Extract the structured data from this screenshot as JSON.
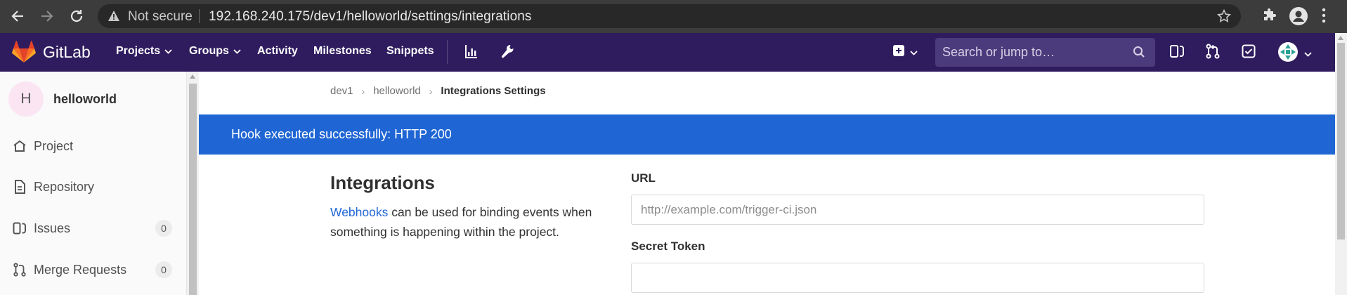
{
  "browser": {
    "security_label": "Not secure",
    "url": "192.168.240.175/dev1/helloworld/settings/integrations"
  },
  "topnav": {
    "brand": "GitLab",
    "items": [
      {
        "label": "Projects"
      },
      {
        "label": "Groups"
      },
      {
        "label": "Activity"
      },
      {
        "label": "Milestones"
      },
      {
        "label": "Snippets"
      }
    ],
    "search_placeholder": "Search or jump to…"
  },
  "sidebar": {
    "project_initial": "H",
    "project_name": "helloworld",
    "items": [
      {
        "label": "Project"
      },
      {
        "label": "Repository"
      },
      {
        "label": "Issues",
        "count": "0"
      },
      {
        "label": "Merge Requests",
        "count": "0"
      }
    ]
  },
  "breadcrumb": {
    "items": [
      "dev1",
      "helloworld"
    ],
    "current": "Integrations Settings"
  },
  "flash": {
    "message": "Hook executed successfully: HTTP 200"
  },
  "section": {
    "title": "Integrations",
    "link_text": "Webhooks",
    "description_rest": " can be used for binding events when something is happening within the project."
  },
  "form": {
    "url_label": "URL",
    "url_placeholder": "http://example.com/trigger-ci.json",
    "url_value": "",
    "token_label": "Secret Token",
    "token_value": ""
  },
  "colors": {
    "nav_bg": "#2f1c5f",
    "flash_bg": "#1f66d4",
    "link": "#1f66d4"
  }
}
